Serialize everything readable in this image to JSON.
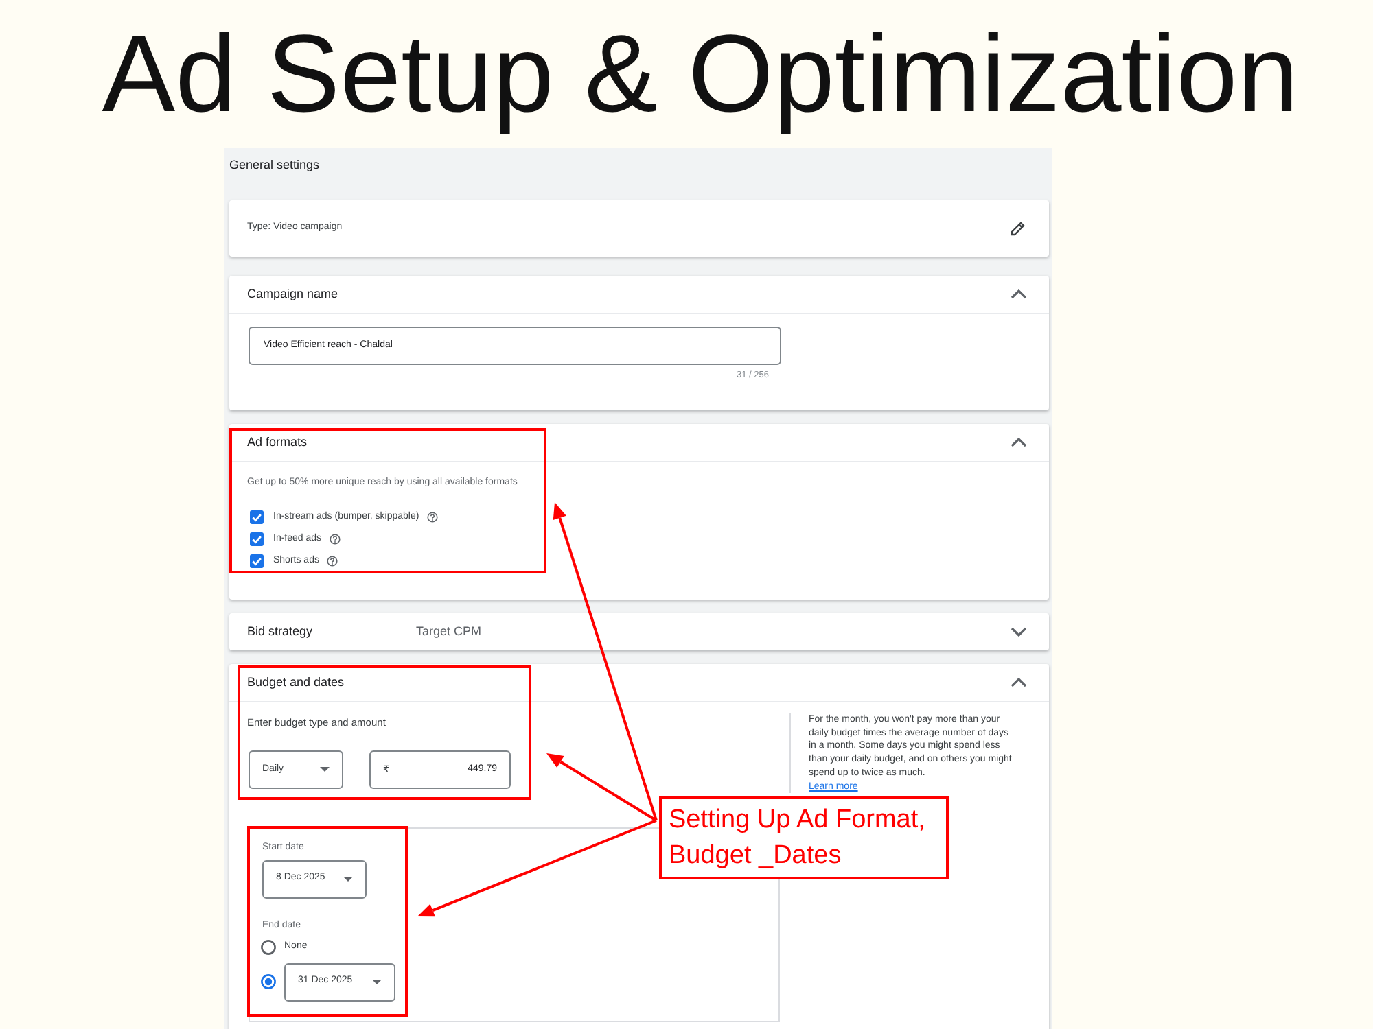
{
  "title": "Ad Setup & Optimization",
  "panel": {
    "heading": "General settings"
  },
  "type_card": {
    "text": "Type: Video campaign"
  },
  "campaign_name": {
    "title": "Campaign name",
    "expanded": true,
    "value": "Video Efficient reach - Chaldal",
    "counter": "31 / 256"
  },
  "ad_formats": {
    "title": "Ad formats",
    "expanded": true,
    "hint": "Get up to 50% more unique reach by using all available formats",
    "options": [
      {
        "label": "In-stream ads (bumper, skippable)",
        "checked": true
      },
      {
        "label": "In-feed ads",
        "checked": true
      },
      {
        "label": "Shorts ads",
        "checked": true
      }
    ]
  },
  "bid_strategy": {
    "title": "Bid strategy",
    "value": "Target CPM",
    "expanded": false
  },
  "budget_and_dates": {
    "title": "Budget and dates",
    "expanded": true,
    "prompt": "Enter budget type and amount",
    "budget_type": "Daily",
    "currency": "₹",
    "amount": "449.79",
    "note": "For the month, you won't pay more than your daily budget times the average number of days in a month. Some days you might spend less than your daily budget, and on others you might spend up to twice as much.",
    "link": "Learn more",
    "start_date": {
      "label": "Start date",
      "value": "8 Dec 2025"
    },
    "end_date": {
      "label": "End date",
      "options": [
        {
          "kind": "none",
          "label": "None",
          "selected": false
        },
        {
          "kind": "date",
          "value": "31 Dec 2025",
          "selected": true
        }
      ]
    }
  },
  "annotation": {
    "lines": [
      "Setting Up Ad Format,",
      "Budget _Dates"
    ]
  }
}
